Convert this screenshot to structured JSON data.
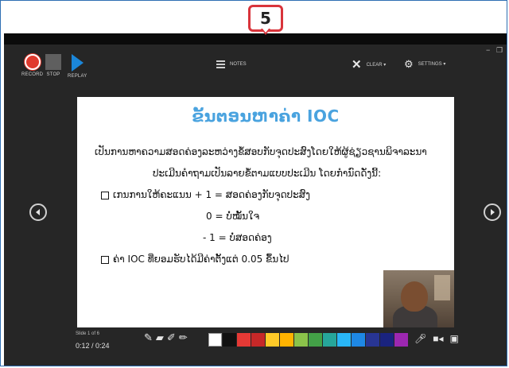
{
  "callout": {
    "number": "5"
  },
  "window_controls": {
    "minimize": "−",
    "restore": "❐"
  },
  "recorder": {
    "record_label": "RECORD",
    "stop_label": "STOP",
    "replay_label": "REPLAY",
    "notes_label": "NOTES",
    "clear_label": "CLEAR ▾",
    "settings_label": "SETTINGS ▾"
  },
  "slide": {
    "title": "ຂັ້ນຕອນຫາຄ່າ IOC",
    "lines": [
      "ເປັນການຫາຄວາມສອດຄ່ອງລະຫວ່າງຂໍ້ສອບກັບຈຸດປະສົງໂດຍໃຫ້ຜູ້ຊ່ຽວຊານພິຈາລະນາ",
      "ປະເມີນຄຳຖາມເປັນລາຍຂໍ້ຕາມແບບປະເມີນ ໂດຍກຳນົດດັ່ງນີ້:",
      "ເກນການໃຫ້ຄະແນນ    + 1 = ສອດຄ່ອງກັບຈຸດປະສົງ",
      "0 = ບໍ່ໝັ້ນໃຈ",
      "- 1 = ບໍ່ສອດຄ່ອງ",
      "ຄ່າ IOC ທີ່ຍອມຮັບໄດ້ມີຄ່າຕັ້ງແຕ່ 0.05 ຂຶ້ນໄປ"
    ]
  },
  "footer": {
    "slide_counter": "Slide 1 of 6",
    "timer": "0:12 / 0:24"
  },
  "palette_colors": [
    "#ffffff",
    "#111111",
    "#e53935",
    "#c62828",
    "#ffca28",
    "#ffb300",
    "#8bc34a",
    "#43a047",
    "#26a69a",
    "#29b6f6",
    "#1e88e5",
    "#283593",
    "#1a237e",
    "#9c27b0"
  ]
}
